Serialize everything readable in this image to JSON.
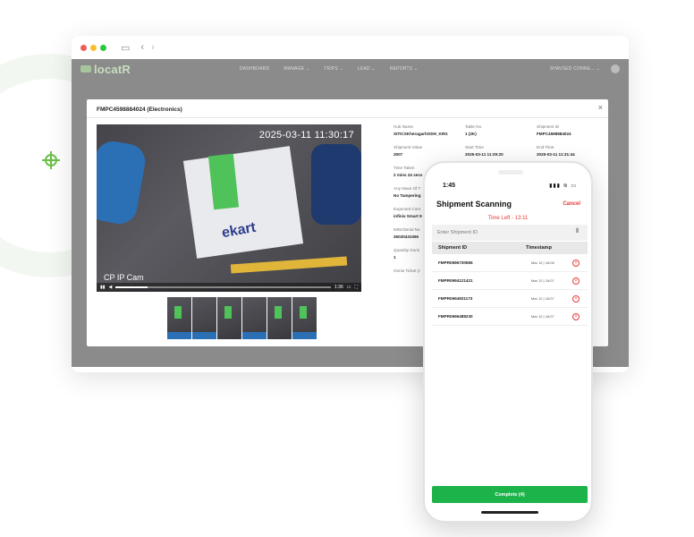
{
  "browser": {
    "nav": {
      "logo": "locatR",
      "items": [
        "DASHBOARD",
        "MANAGE ⌄",
        "TRIPS ⌄",
        "LEAD ⌄",
        "REPORTS ⌄"
      ],
      "user": "SHAVSED CONNE... ⌄"
    },
    "modal": {
      "title": "FMPC4598884024 (Electronics)",
      "close": "×",
      "video": {
        "timestamp": "2025-03-11 11:30:17",
        "camera": "CP IP Cam",
        "box_text": "ekart",
        "time_current": "1:36"
      },
      "details": {
        "hub_name_label": "Hub Name",
        "hub_name": "SITICSKheragarhODH_KRG",
        "table_no_label": "Table No",
        "table_no": "1 (2K)",
        "shipment_id_label": "Shipment ID",
        "shipment_id": "FMPC4598884024",
        "shipment_value_label": "Shipment Value",
        "shipment_value": "3007",
        "start_time_label": "Start Time",
        "start_time": "2025-03-11 11:29:20",
        "end_time_label": "End Time",
        "end_time": "2025-03-11 11:31:44",
        "time_taken_label": "Time Taken",
        "time_taken": "2 mins 24 secs",
        "issue_label": "Any Issue Of T",
        "issue": "No Tampering",
        "expected_label": "Expected Cont",
        "expected": "infinix Smart 9",
        "imei_label": "IMEI/Serial No",
        "imei": "35030431065",
        "quantity_label": "Quantity Durin",
        "quantity": "1",
        "genie_label": "Genie Ticket (I"
      }
    }
  },
  "phone": {
    "status_time": "1:45",
    "status_icons": "▮▮▮ ≋ ▭",
    "title": "Shipment Scanning",
    "cancel": "Cancel",
    "timer": "Time Left - 13:11",
    "search_placeholder": "Enter Shipment ID",
    "scan_icon": "scan-barcode-icon",
    "columns": {
      "id": "Shipment ID",
      "timestamp": "Timestamp"
    },
    "rows": [
      {
        "id": "FMPR0696730565",
        "timestamp": "Mar 12 | 18:08"
      },
      {
        "id": "FMPR0694121421",
        "timestamp": "Mar 12 | 18:07"
      },
      {
        "id": "FMPR0694831173",
        "timestamp": "Mar 12 | 18:07"
      },
      {
        "id": "FMPR0696488230",
        "timestamp": "Mar 12 | 18:07"
      }
    ],
    "complete_label": "Complete  (4)"
  },
  "colors": {
    "accent_green": "#1db34b",
    "accent_red": "#e53935",
    "app_overlay": "#8b8b8b"
  }
}
